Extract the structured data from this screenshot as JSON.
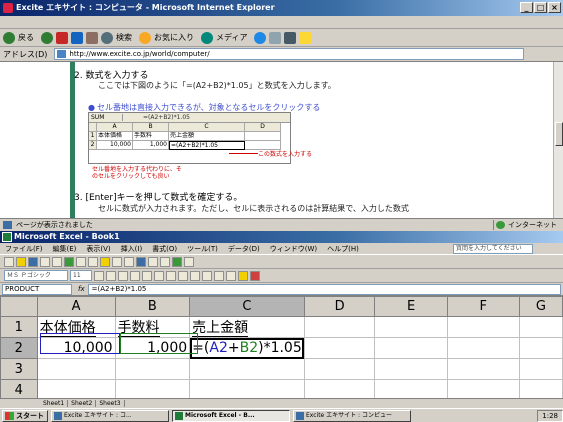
{
  "ie": {
    "title": "Excite エキサイト : コンピュータ - Microsoft Internet Explorer",
    "toolbar": {
      "back": "戻る",
      "search": "検索",
      "favorites": "お気に入り",
      "media": "メディア"
    },
    "address_label": "アドレス(D)",
    "address": "http://www.excite.co.jp/world/computer/",
    "status": "ページが表示されました",
    "zone": "インターネット",
    "article": {
      "step2_title": "2. 数式を入力する",
      "step2_body": "ここでは下図のように「=(A2+B2)*1.05」と数式を入力します。",
      "tip": "セル番地は直接入力できるが、対象となるセルをクリックする",
      "step3_title": "3. [Enter]キーを押して数式を確定する。",
      "step3_body": "セルに数式が入力されます。ただし、セルに表示されるのは計算結果で、入力した数式",
      "callout_formula": "この数式を入力する",
      "callout_click": "セル番地を入力する代わりに、そのセルをクリックしても良い",
      "mini": {
        "namebox": "SUM",
        "formula": "=(A2+B2)*1.05",
        "cols": [
          "A",
          "B",
          "C",
          "D"
        ],
        "row1": [
          "本体価格",
          "手数料",
          "売上金額",
          ""
        ],
        "row2": [
          "10,000",
          "1,000",
          "=(A2+B2)*1.05",
          ""
        ]
      }
    }
  },
  "excel": {
    "title": "Microsoft Excel - Book1",
    "menu": [
      "ファイル(F)",
      "編集(E)",
      "表示(V)",
      "挿入(I)",
      "書式(O)",
      "ツール(T)",
      "データ(D)",
      "ウィンドウ(W)",
      "ヘルプ(H)"
    ],
    "help_placeholder": "質問を入力してください",
    "font_name": "ＭＳ Ｐゴシック",
    "font_size": "11",
    "namebox": "PRODUCT",
    "formula": "=(A2+B2)*1.05",
    "columns": [
      "A",
      "B",
      "C",
      "D",
      "E",
      "F",
      "G"
    ],
    "rows": [
      "1",
      "2",
      "3",
      "4"
    ],
    "cells": {
      "A1": "本体価格",
      "B1": "手数料",
      "C1": "売上金額",
      "A2": "10,000",
      "B2": "1,000",
      "C2_prefix": "=(",
      "C2_a": "A2",
      "C2_plus": "+",
      "C2_b": "B2",
      "C2_suffix": ")*1.05"
    },
    "sheets": [
      "Sheet1",
      "Sheet2",
      "Sheet3"
    ]
  },
  "taskbar": {
    "start": "スタート",
    "tasks": [
      "Excite エキサイト : コ...",
      "Microsoft Excel - B...",
      "Excite エキサイト : コンピュー"
    ],
    "clock": "1:28"
  }
}
